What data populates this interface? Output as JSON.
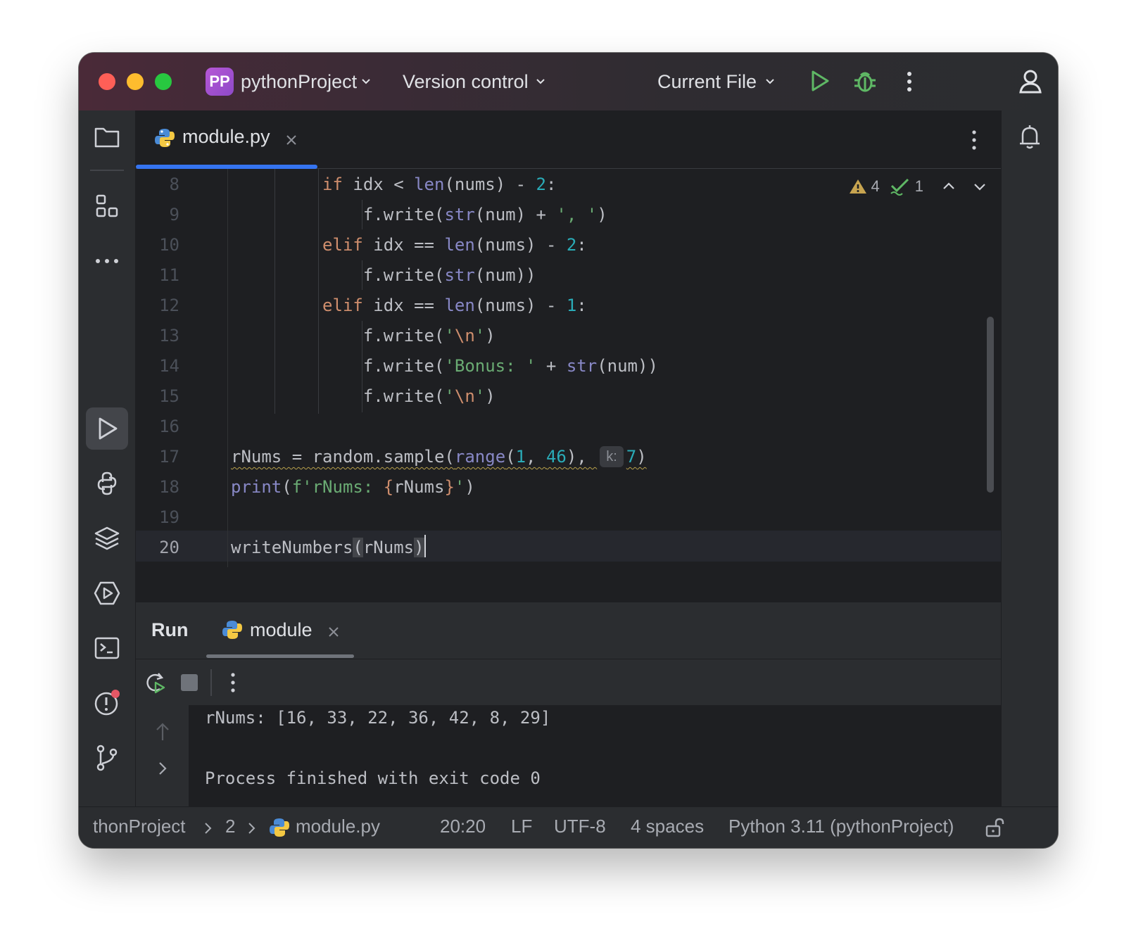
{
  "titlebar": {
    "project_badge": "PP",
    "project_name": "pythonProject",
    "vcs_label": "Version control",
    "run_config": "Current File"
  },
  "editor": {
    "tab_label": "module.py",
    "inspections": {
      "warnings": "4",
      "ok": "1"
    },
    "param_hint": "k:",
    "line_numbers": [
      "8",
      "9",
      "10",
      "11",
      "12",
      "13",
      "14",
      "15",
      "16",
      "17",
      "18",
      "19",
      "20"
    ],
    "current_line": "20"
  },
  "run": {
    "title": "Run",
    "tab_label": "module",
    "output": [
      "rNums: [16, 33, 22, 36, 42, 8, 29]",
      "",
      "Process finished with exit code 0"
    ]
  },
  "statusbar": {
    "breadcrumb_project": "thonProject",
    "breadcrumb_folder": "2",
    "breadcrumb_file": "module.py",
    "position": "20:20",
    "line_sep": "LF",
    "encoding": "UTF-8",
    "indent": "4 spaces",
    "interpreter": "Python 3.11 (pythonProject)"
  },
  "colors": {
    "accent": "#3574f0",
    "keyword": "#cf8e6d",
    "builtin": "#8888c6",
    "number": "#2aacb8",
    "string": "#6aab73",
    "run_green": "#5fb865"
  },
  "icons": [
    "folder-icon",
    "structure-icon",
    "more-icon",
    "run-icon",
    "python-console-icon",
    "layers-icon",
    "services-icon",
    "terminal-icon",
    "problems-icon",
    "git-icon",
    "bell-icon",
    "debug-icon",
    "user-icon",
    "rerun-icon",
    "stop-icon",
    "lock-icon"
  ]
}
